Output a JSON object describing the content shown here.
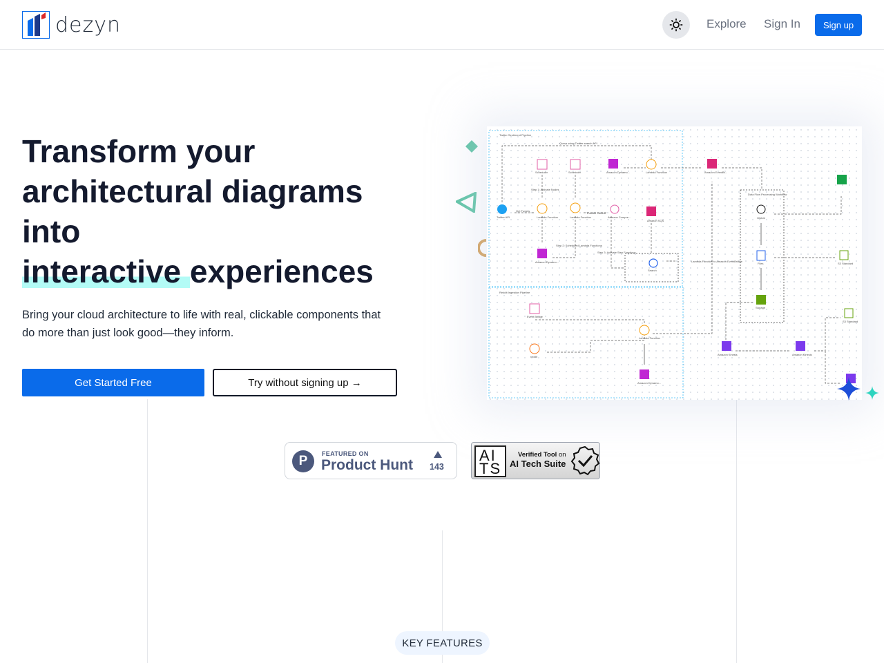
{
  "brand": {
    "name": "dezyn"
  },
  "nav": {
    "explore": "Explore",
    "sign_in": "Sign In",
    "sign_up": "Sign up"
  },
  "hero": {
    "title_line1": "Transform your",
    "title_line2": "architectural diagrams",
    "title_line3": "into",
    "title_highlight": "interactive",
    "title_tail": "experiences",
    "subtitle": "Bring your cloud architecture to life with real, clickable components that do more than just look good—they inform.",
    "cta_primary": "Get Started Free",
    "cta_secondary": "Try without signing up →"
  },
  "diagram": {
    "group_top": "Twitter Sentiment Pipeline",
    "group_bottom": "Reddit Ingestion Pipeline",
    "group_right": "Data Flow Processing Workflow",
    "labels": {
      "query": "Query using Twitter search API",
      "step1": "Step 1: Activate Nodes",
      "step2": "Step 2: Scheduled Lambda Functions",
      "step3": "Step 3: Activate Step Functions",
      "get_tweets": "Get Tweets",
      "publish": "Publish Tweets",
      "lambda_event": "Lambda Function to Amazon EventBridge",
      "lambda_search": "Lambda Search"
    },
    "nodes": {
      "scheduler": "Scheduler",
      "dynamo": "Amazon Dynamo...",
      "lambda": "Lambda Function",
      "eventbridge": "Amazon EventBr...",
      "twitter": "Twitter API",
      "sqs": "Amazon SQS",
      "comprehend": "Amazon Compre...",
      "search": "Search",
      "opensearch": "AWS Search",
      "global": "Global",
      "files": "Files",
      "storage": "Storage",
      "s3": "S3 Standard",
      "event_bridge": "Event Bridge",
      "reddit": "reddit",
      "kinesis": "Amazon Kinesis"
    }
  },
  "badges": {
    "producthunt": {
      "featured": "FEATURED ON",
      "name": "Product Hunt",
      "count": "143"
    },
    "ai": {
      "verified": "Verified Tool",
      "on": "on",
      "name": "AI Tech Suite",
      "box": "AI TS"
    }
  },
  "features": {
    "pill": "KEY FEATURES"
  },
  "colors": {
    "accent": "#0a6bea",
    "highlight": "#b3fbf6",
    "ph": "#4b587c"
  }
}
